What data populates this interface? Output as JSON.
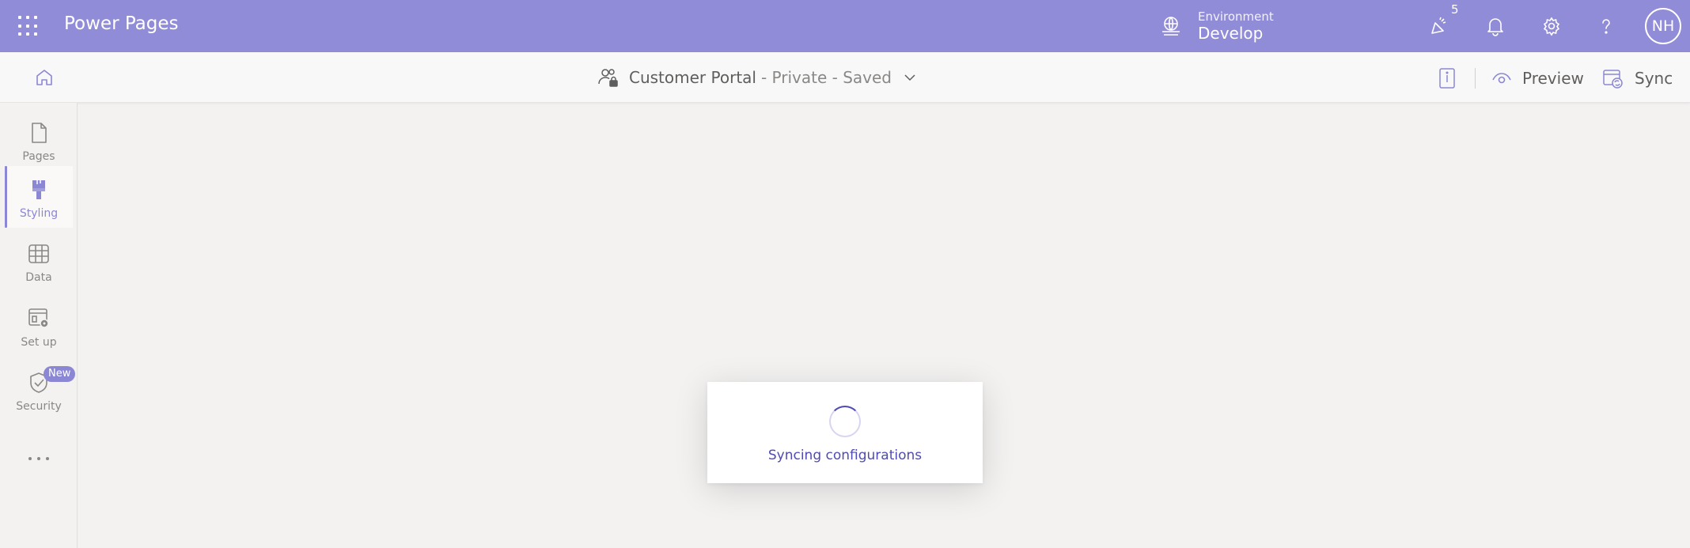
{
  "app": {
    "title": "Power Pages",
    "brand_color": "#918cd8",
    "accent_color": "#8b87d4"
  },
  "header": {
    "environment_label": "Environment",
    "environment_value": "Develop",
    "notification_badge": "5",
    "user_initials": "NH",
    "icons": [
      "waffle-icon",
      "environment-icon",
      "celebrate-icon",
      "bell-icon",
      "gear-icon",
      "help-icon"
    ]
  },
  "subheader": {
    "site_name": "Customer Portal",
    "site_status": "- Private - Saved",
    "preview_label": "Preview",
    "sync_label": "Sync"
  },
  "sidebar": {
    "items": [
      {
        "label": "Pages",
        "icon": "page-icon",
        "active": false
      },
      {
        "label": "Styling",
        "icon": "paintbrush-icon",
        "active": true
      },
      {
        "label": "Data",
        "icon": "table-icon",
        "active": false
      },
      {
        "label": "Set up",
        "icon": "setup-icon",
        "active": false
      },
      {
        "label": "Security",
        "icon": "shield-icon",
        "active": false,
        "badge": "New"
      }
    ]
  },
  "loading": {
    "message": "Syncing configurations"
  }
}
